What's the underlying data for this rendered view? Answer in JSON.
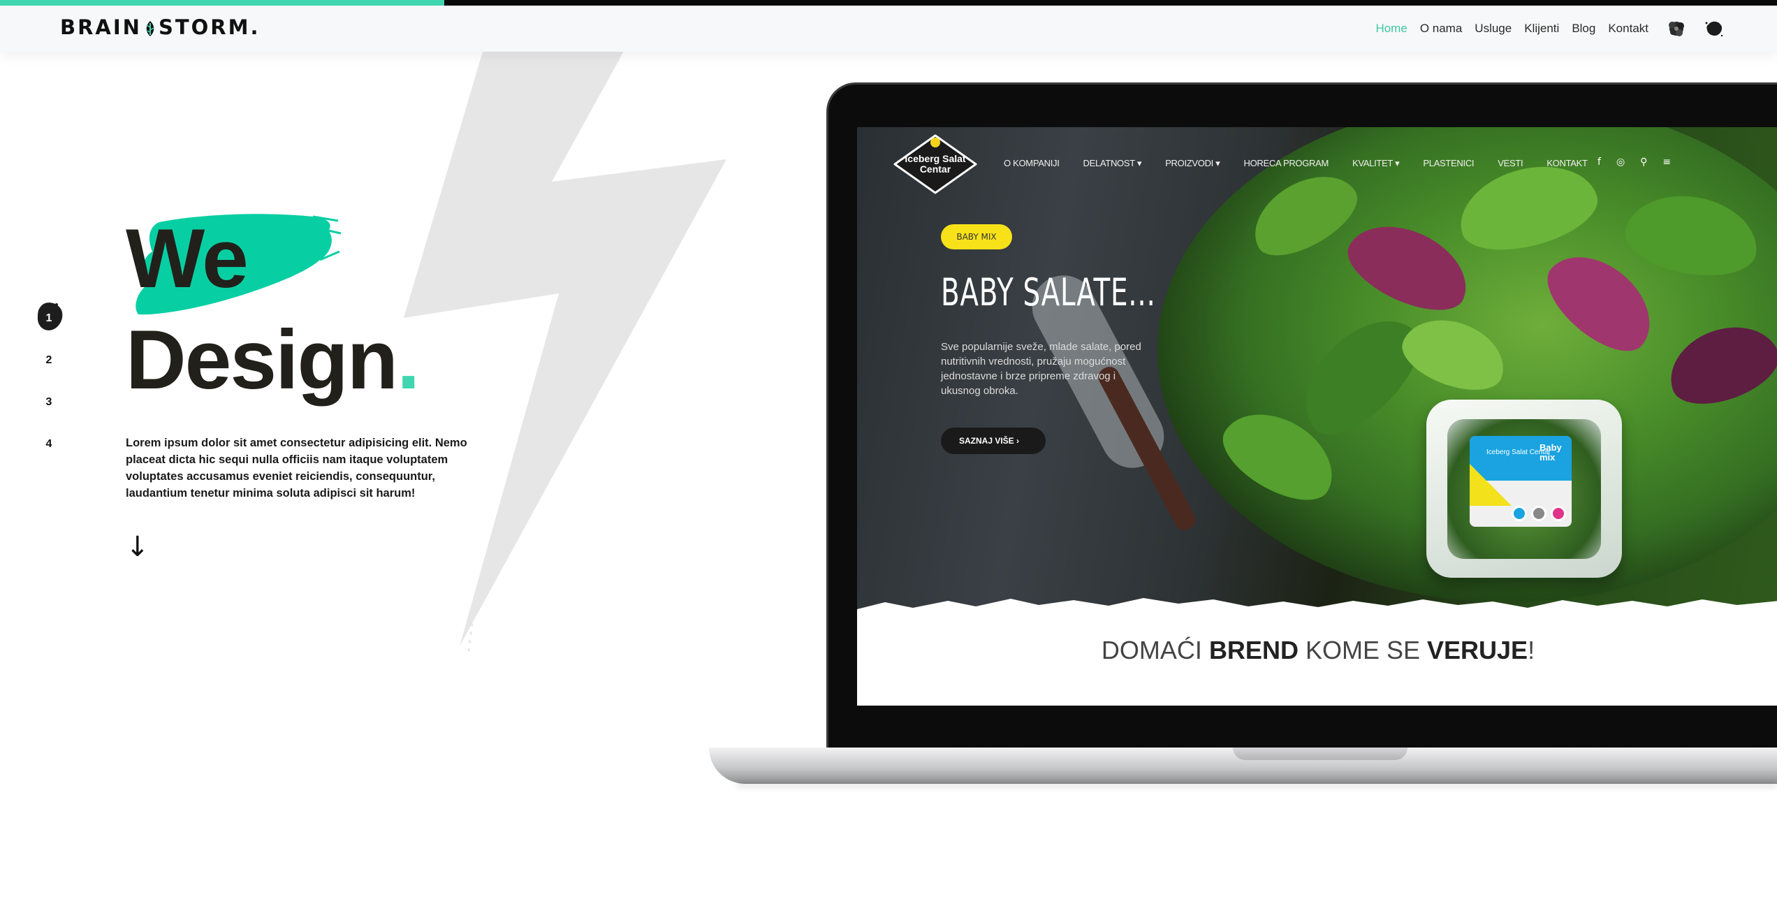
{
  "progress": {
    "value": 0.25,
    "color": "#3fd6b0"
  },
  "header": {
    "logo_left": "BRAIN",
    "logo_right": "STORM.",
    "nav": [
      {
        "label": "Home",
        "active": true
      },
      {
        "label": "O nama",
        "active": false
      },
      {
        "label": "Usluge",
        "active": false
      },
      {
        "label": "Klijenti",
        "active": false
      },
      {
        "label": "Blog",
        "active": false
      },
      {
        "label": "Kontakt",
        "active": false
      }
    ],
    "icons": [
      "flower-blob-icon",
      "ink-blob-icon"
    ]
  },
  "slider": {
    "items": [
      "1",
      "2",
      "3",
      "4"
    ],
    "active_index": 0
  },
  "hero": {
    "line1": "We",
    "line2": "Design",
    "dot": ".",
    "body": "Lorem ipsum dolor sit amet consectetur adipisicing elit. Nemo placeat dicta hic sequi nulla officiis nam itaque voluptatem voluptates accusamus eveniet reiciendis, consequuntur, laudantium tenetur minima soluta adipisci sit harum!",
    "scroll_arrow": "↓"
  },
  "showcase": {
    "site_logo": "Iceberg Salat Centar",
    "menu": [
      "O KOMPANIJI",
      "DELATNOST ▾",
      "PROIZVODI ▾",
      "HORECA PROGRAM",
      "KVALITET ▾",
      "PLASTENICI",
      "VESTI",
      "KONTAKT"
    ],
    "icons": [
      "f",
      "◎",
      "⚲",
      "≡"
    ],
    "badge": "BABY MIX",
    "title": "BABY SALATE...",
    "description": "Sve popularnije sveže, mlade salate, pored nutritivnih vrednosti, pružaju mogućnost jednostavne i brze pripreme zdravog i ukusnog obroka.",
    "button": "SAZNAJ VIŠE  ›",
    "pack_brand": "Iceberg Salat Centar",
    "pack_label": "Baby mix",
    "slogan_1": "DOMAĆI ",
    "slogan_2": "BREND",
    "slogan_3": " KOME SE ",
    "slogan_4": "VERUJE",
    "slogan_5": "!"
  },
  "colors": {
    "accent": "#3fd6b0",
    "nav_active": "#3fc8a0",
    "text_dark": "#22201a",
    "badge_yellow": "#f7e21a"
  }
}
